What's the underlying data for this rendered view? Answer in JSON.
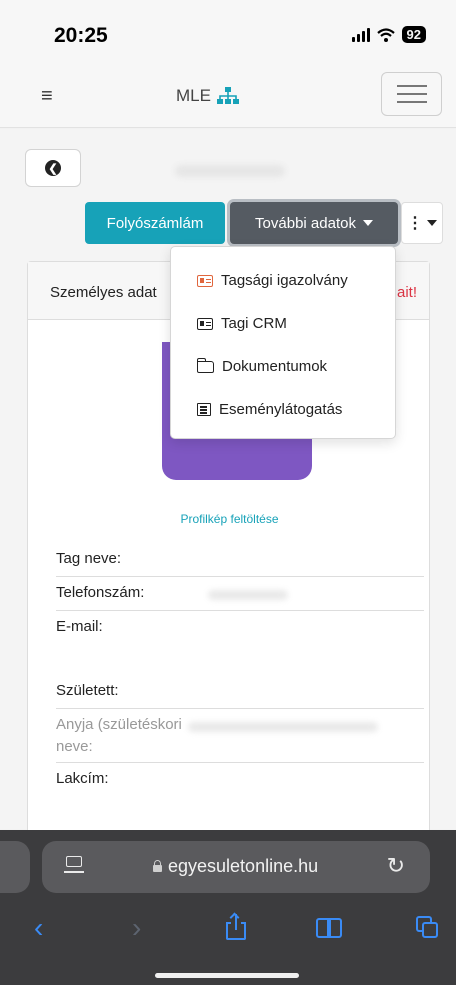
{
  "status_bar": {
    "time": "20:25",
    "battery": "92"
  },
  "navbar": {
    "brand": "MLE"
  },
  "actions": {
    "account_button": "Folyószámlám",
    "more_data_button": "További adatok"
  },
  "card": {
    "title": "Személyes adat",
    "warning_fragment": "ait!",
    "upload_link": "Profilkép feltöltése",
    "fields": {
      "member_name": "Tag neve:",
      "phone": "Telefonszám:",
      "email": "E-mail:",
      "born": "Született:",
      "mother_name": "Anyja (születéskori",
      "mother_name_cont": "neve:",
      "address": "Lakcím:"
    }
  },
  "dropdown": {
    "items": [
      {
        "label": "Tagsági igazolvány",
        "icon": "id-card-icon"
      },
      {
        "label": "Tagi CRM",
        "icon": "id-card-icon"
      },
      {
        "label": "Dokumentumok",
        "icon": "folder-open-icon"
      },
      {
        "label": "Eseménylátogatás",
        "icon": "list-alt-icon"
      }
    ]
  },
  "browser": {
    "url": "egyesuletonline.hu"
  },
  "colors": {
    "primary": "#17a2b8",
    "dark": "#555b62",
    "danger": "#dc3545",
    "avatar": "#7e57c2",
    "ios_blue": "#3a8bf5"
  }
}
